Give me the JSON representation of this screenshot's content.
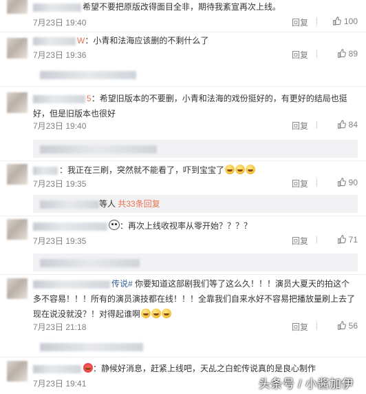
{
  "comments": [
    {
      "text": "希望不要把原版改得面目全非，期待我紊宣再次上线。",
      "time": "7月23日 19:40",
      "reply_label": "回复",
      "likes": "100"
    },
    {
      "name_suffix": "W",
      "text": "：小青和法海应该删的不剩什么了",
      "time": "7月23日 19:36",
      "reply_label": "回复",
      "likes": "89"
    },
    {
      "name_suffix": "5",
      "text": "：希望旧版本的不要删，小青和法海的戏份挺好的，有更好的结局也挺好，但是旧版本也很好",
      "time": "7月23日 19:40",
      "reply_label": "回复",
      "likes": "84"
    },
    {
      "text": "：我正在三刷，突然就不能看了，吓到宝宝了",
      "time": "7月23日 19:35",
      "reply_label": "回复",
      "likes": "90",
      "sub_reply": {
        "suffix": "等人",
        "link": "共33条回复"
      }
    },
    {
      "text": "：再次上线收视率从零开始？？？？",
      "time": "7月23日 19:35",
      "reply_label": "回复",
      "likes": "71"
    },
    {
      "topic": "传说#",
      "text": " 你要知道这部剧我们等了这么久！！！演员大夏天的拍这个多不容易！！！所有的演员演技都在线！！！全靠我们自来水好不容易把播放量刷上去了现在说没就没？！对得起谁啊",
      "time": "7月23日 21:18",
      "reply_label": "回复",
      "likes": "56"
    },
    {
      "text": "：静候好消息，赶紧上线吧，天乩之白蛇传说真的是良心制作",
      "time": "7月23日 19:41"
    }
  ],
  "watermark": "头条号 / 小酱加伊"
}
